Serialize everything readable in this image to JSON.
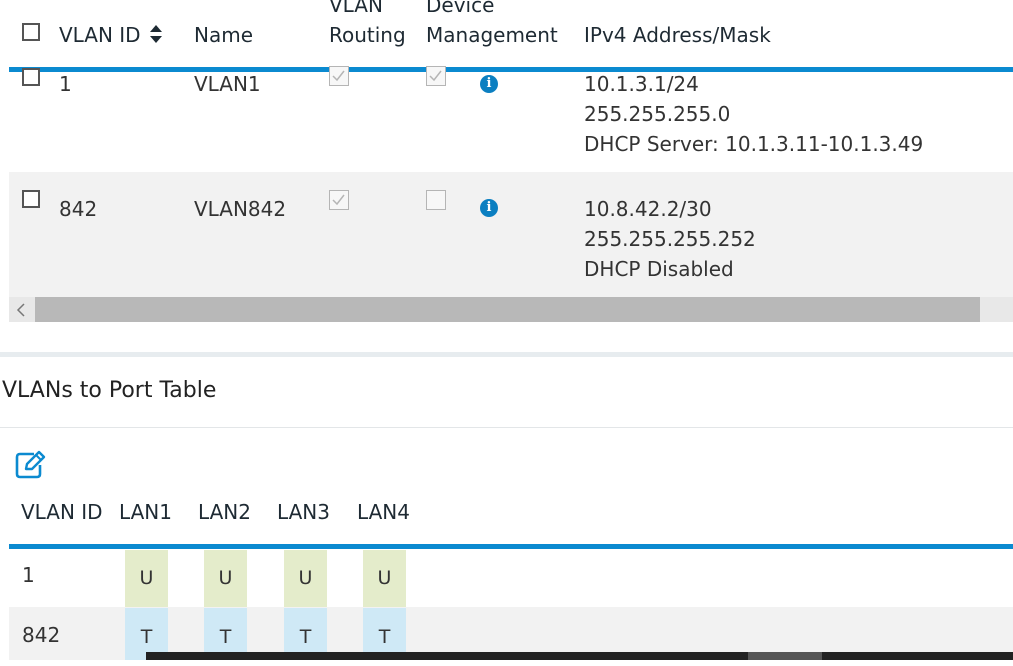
{
  "vlan_table": {
    "columns": {
      "vlan_id": "VLAN ID",
      "name": "Name",
      "vlan_routing_1": "VLAN",
      "vlan_routing_2": "Routing",
      "device_mgmt_1": "Device",
      "device_mgmt_2": "Management",
      "ipv4": "IPv4 Address/Mask"
    },
    "rows": [
      {
        "id": "1",
        "name": "VLAN1",
        "routing_checked": true,
        "management_checked": true,
        "ip": "10.1.3.1/24",
        "mask": "255.255.255.0",
        "dhcp": "DHCP Server: 10.1.3.11-10.1.3.49"
      },
      {
        "id": "842",
        "name": "VLAN842",
        "routing_checked": true,
        "management_checked": false,
        "ip": "10.8.42.2/30",
        "mask": "255.255.255.252",
        "dhcp": "DHCP Disabled"
      }
    ]
  },
  "port_table": {
    "title": "VLANs to Port Table",
    "columns": [
      "VLAN ID",
      "LAN1",
      "LAN2",
      "LAN3",
      "LAN4"
    ],
    "rows": [
      {
        "id": "1",
        "ports": [
          "U",
          "U",
          "U",
          "U"
        ]
      },
      {
        "id": "842",
        "ports": [
          "T",
          "T",
          "T",
          "T"
        ]
      }
    ]
  },
  "icons": {
    "sort": "sort-icon",
    "info": "info-icon",
    "edit": "edit-icon",
    "scroll_left": "chevron-left-icon"
  },
  "colors": {
    "accent": "#0b8ad0",
    "untagged": "#e4eccb",
    "tagged": "#cfe9f6",
    "scroll_thumb": "#b8b8b8"
  }
}
